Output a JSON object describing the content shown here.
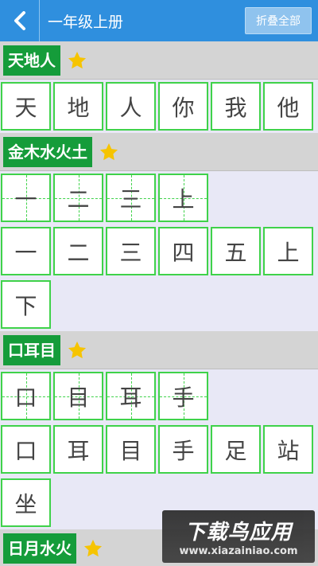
{
  "header": {
    "back_icon": "chevron-left-icon",
    "title": "一年级上册",
    "collapse_label": "折叠全部"
  },
  "colors": {
    "header": "#2f8fde",
    "section_tag": "#159c3a",
    "cell_border": "#3fd24a",
    "star": "#f6c400"
  },
  "sections": [
    {
      "title": "天地人",
      "starred": true,
      "rows": [
        {
          "kind": "plain",
          "chars": [
            "天",
            "地",
            "人",
            "你",
            "我",
            "他"
          ]
        }
      ]
    },
    {
      "title": "金木水火土",
      "starred": true,
      "rows": [
        {
          "kind": "stroke",
          "chars": [
            "一",
            "二",
            "三",
            "上"
          ]
        },
        {
          "kind": "plain",
          "chars": [
            "一",
            "二",
            "三",
            "四",
            "五",
            "上"
          ]
        },
        {
          "kind": "plain",
          "chars": [
            "下"
          ]
        }
      ]
    },
    {
      "title": "口耳目",
      "starred": true,
      "rows": [
        {
          "kind": "stroke",
          "chars": [
            "口",
            "目",
            "耳",
            "手"
          ]
        },
        {
          "kind": "plain",
          "chars": [
            "口",
            "耳",
            "目",
            "手",
            "足",
            "站"
          ]
        },
        {
          "kind": "plain",
          "chars": [
            "坐"
          ]
        }
      ]
    },
    {
      "title": "日月水火",
      "starred": true,
      "rows": []
    }
  ],
  "watermark": {
    "main": "下载鸟应用",
    "url": "www.xiazainiao.com"
  }
}
